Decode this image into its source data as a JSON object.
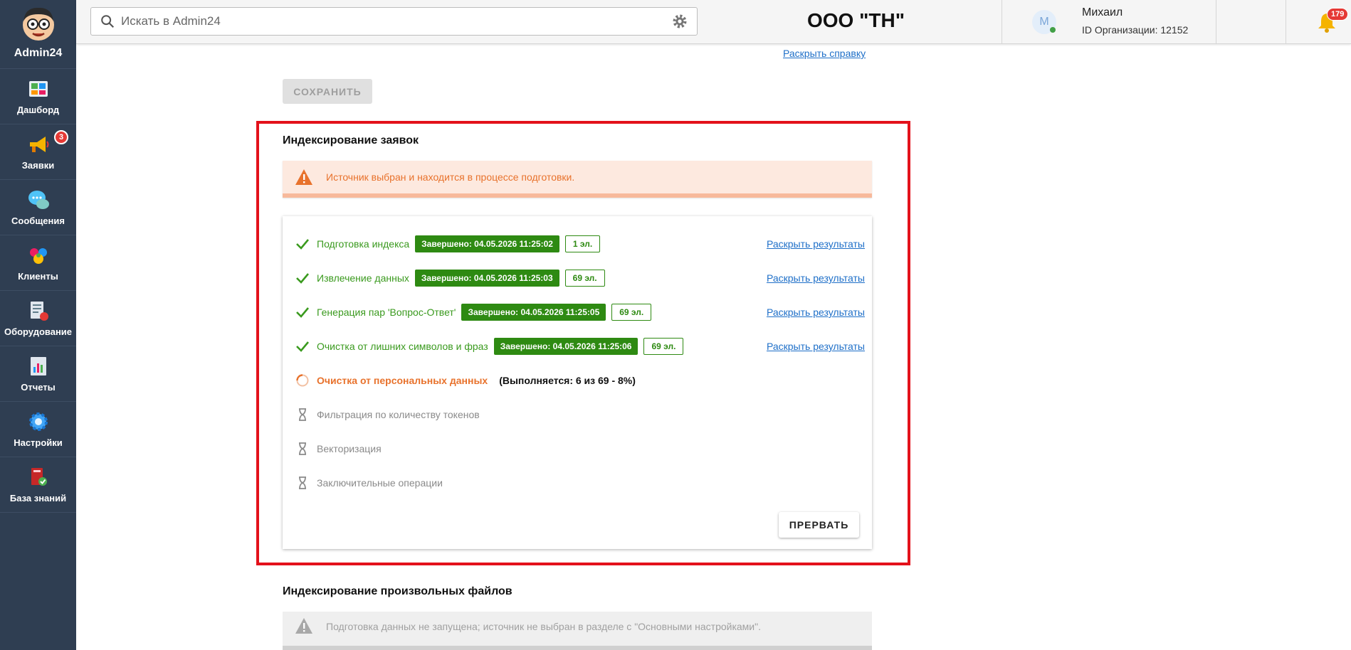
{
  "app": {
    "brand": "Admin24"
  },
  "sidebar": {
    "items": [
      {
        "label": "Дашборд",
        "icon": "dashboard-icon"
      },
      {
        "label": "Заявки",
        "icon": "megaphone-icon",
        "badge": "3"
      },
      {
        "label": "Сообщения",
        "icon": "chat-icon"
      },
      {
        "label": "Клиенты",
        "icon": "clients-icon"
      },
      {
        "label": "Оборудование",
        "icon": "equipment-icon"
      },
      {
        "label": "Отчеты",
        "icon": "reports-icon"
      },
      {
        "label": "Настройки",
        "icon": "settings-icon"
      },
      {
        "label": "База знаний",
        "icon": "knowledge-base-icon"
      }
    ]
  },
  "header": {
    "search_placeholder": "Искать в Admin24",
    "org_title": "ООО \"ТН\"",
    "user_initial": "М",
    "user_name": "Михаил",
    "org_id": "ID Организации: 12152",
    "notifications_count": "179",
    "help_label": "?"
  },
  "content": {
    "help_link": "Раскрыть справку",
    "save_label": "СОХРАНИТЬ",
    "indexing_requests": {
      "title": "Индексирование заявок",
      "warning": "Источник выбран и находится в процессе подготовки.",
      "steps": [
        {
          "label": "Подготовка индекса",
          "status": "Завершено: 04.05.2026 11:25:02",
          "count": "1 эл.",
          "link": "Раскрыть результаты"
        },
        {
          "label": "Извлечение данных",
          "status": "Завершено: 04.05.2026 11:25:03",
          "count": "69 эл.",
          "link": "Раскрыть результаты"
        },
        {
          "label": "Генерация пар 'Вопрос-Ответ'",
          "status": "Завершено: 04.05.2026 11:25:05",
          "count": "69 эл.",
          "link": "Раскрыть результаты"
        },
        {
          "label": "Очистка от лишних символов и фраз",
          "status": "Завершено: 04.05.2026 11:25:06",
          "count": "69 эл.",
          "link": "Раскрыть результаты"
        },
        {
          "label": "Очистка от персональных данных",
          "progress": "(Выполняется: 6 из 69 - 8%)"
        },
        {
          "label": "Фильтрация по количеству токенов"
        },
        {
          "label": "Векторизация"
        },
        {
          "label": "Заключительные операции"
        }
      ],
      "abort_label": "ПРЕРВАТЬ"
    },
    "indexing_files": {
      "title": "Индексирование произвольных файлов",
      "info": "Подготовка данных не запущена; источник не выбран в разделе с \"Основными настройками\"."
    }
  },
  "colors": {
    "sidebar_bg": "#2f3e52",
    "success": "#2e8a12",
    "warning": "#e8722c",
    "highlight": "#e3111b",
    "link": "#1e6fc8"
  }
}
